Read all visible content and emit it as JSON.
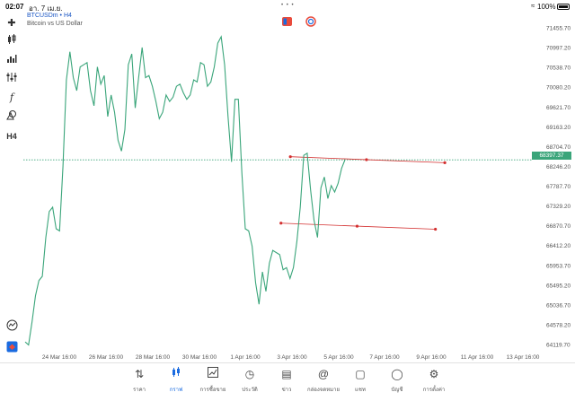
{
  "status": {
    "time": "02:07",
    "date": "อา. 7 เม.ย.",
    "battery": "100%",
    "dots": "• • •"
  },
  "header": {
    "symbol": "BTCUSDm • H4",
    "description": "Bitcoin vs US Dollar"
  },
  "left_toolbar": {
    "icons": [
      "crosshair-icon",
      "candles-icon",
      "bar-chart-icon",
      "indicator-icon",
      "function-icon",
      "shapes-icon",
      "timeframe-icon"
    ],
    "timeframe": "H4"
  },
  "chart_data": {
    "type": "line",
    "series": [
      {
        "values": [
          64180,
          64110,
          64650,
          65250,
          65600,
          65700,
          66600,
          67200,
          67300,
          66800,
          66750,
          68250,
          70250,
          70900,
          70300,
          70000,
          70550,
          70600,
          70650,
          70000,
          69650,
          70550,
          70150,
          70350,
          69400,
          69900,
          69500,
          68850,
          68600,
          69100,
          70600,
          70850,
          69600,
          70300,
          71000,
          70300,
          70350,
          70100,
          69750,
          69350,
          69500,
          69900,
          69750,
          69850,
          70100,
          70150,
          69950,
          69800,
          69900,
          70250,
          70200,
          70650,
          70600,
          70100,
          70200,
          70550,
          71100,
          71250,
          70600,
          69400,
          68350,
          69800,
          69800,
          68100,
          66800,
          66750,
          66400,
          65550,
          65050,
          65800,
          65350,
          66000,
          66300,
          66250,
          66200,
          65850,
          65900,
          65650,
          65900,
          66500,
          67300,
          68500,
          68550,
          67700,
          67000,
          66600,
          67750,
          68000,
          67500,
          67800,
          67650,
          67850,
          68200,
          68400
        ]
      }
    ],
    "x_ticks": [
      "24 Mar 16:00",
      "26 Mar 16:00",
      "28 Mar 16:00",
      "30 Mar 16:00",
      "1 Apr 16:00",
      "3 Apr 16:00",
      "5 Apr 16:00",
      "7 Apr 16:00",
      "9 Apr 16:00",
      "11 Apr 16:00",
      "13 Apr 16:00"
    ],
    "y_ticks": [
      "71455.70",
      "70997.20",
      "70538.70",
      "70080.20",
      "69621.70",
      "69163.20",
      "68704.70",
      "68246.20",
      "67787.70",
      "67329.20",
      "66870.70",
      "66412.20",
      "65953.70",
      "65495.20",
      "65036.70",
      "64578.20",
      "64119.70"
    ],
    "ylim": [
      64119.7,
      71455.7
    ],
    "current_price": "68397.37",
    "current_price_value": 68397.37,
    "color": "#3aa57a",
    "trendline_color": "#d32f2f",
    "trendlines": [
      {
        "points": [
          [
            0.484,
            68470
          ],
          [
            0.622,
            68400
          ],
          [
            0.764,
            68330
          ]
        ]
      },
      {
        "points": [
          [
            0.467,
            66930
          ],
          [
            0.605,
            66860
          ],
          [
            0.747,
            66790
          ]
        ]
      }
    ]
  },
  "nav": [
    {
      "label": "ราคา",
      "icon": "quotes-icon"
    },
    {
      "label": "กราฟ",
      "icon": "chart-icon"
    },
    {
      "label": "การซื้อขาย",
      "icon": "trade-icon"
    },
    {
      "label": "ประวัติ",
      "icon": "history-icon"
    },
    {
      "label": "ข่าว",
      "icon": "news-icon"
    },
    {
      "label": "กล่องจดหมาย",
      "icon": "mailbox-icon"
    },
    {
      "label": "แชท",
      "icon": "chat-icon"
    },
    {
      "label": "บัญชี",
      "icon": "account-icon"
    },
    {
      "label": "การตั้งค่า",
      "icon": "settings-icon"
    }
  ],
  "active_nav": "กราฟ"
}
